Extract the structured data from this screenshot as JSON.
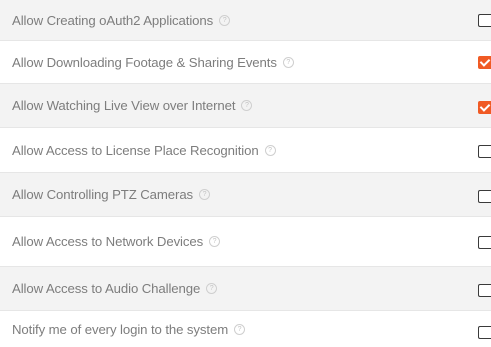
{
  "colors": {
    "accent": "#f05a24",
    "row_shaded": "#f3f3f3",
    "row_plain": "#ffffff",
    "text": "#7d7d7d"
  },
  "help_icon": "question-circle-icon",
  "permissions": [
    {
      "label": "Allow Creating oAuth2 Applications",
      "checked": false
    },
    {
      "label": "Allow Downloading Footage & Sharing Events",
      "checked": true
    },
    {
      "label": "Allow Watching Live View over Internet",
      "checked": true
    },
    {
      "label": "Allow Access to License Place Recognition",
      "checked": false
    },
    {
      "label": "Allow Controlling PTZ Cameras",
      "checked": false
    },
    {
      "label": "Allow Access to Network Devices",
      "checked": false
    },
    {
      "label": "Allow Access to Audio Challenge",
      "checked": false
    },
    {
      "label": "Notify me of every login to the system",
      "checked": false
    }
  ]
}
